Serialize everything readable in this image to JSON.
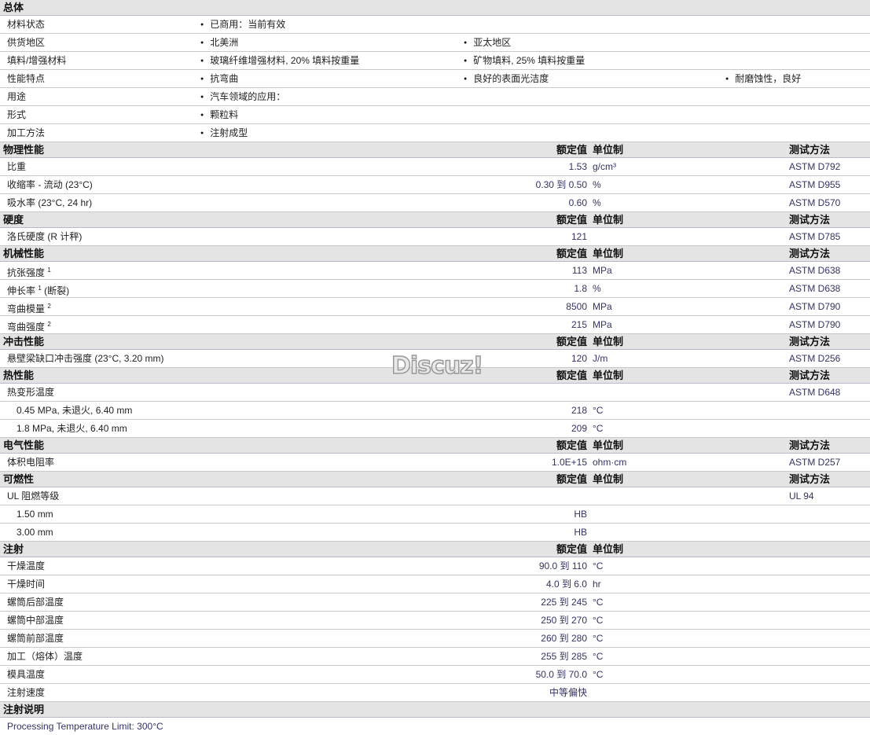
{
  "general": {
    "title": "总体",
    "rows": [
      {
        "label": "材料状态",
        "items": [
          "已商用：当前有效"
        ]
      },
      {
        "label": "供货地区",
        "items": [
          "北美洲",
          "亚太地区"
        ]
      },
      {
        "label": "填料/增强材料",
        "items": [
          "玻璃纤维增强材料, 20% 填料按重量",
          "矿物填料, 25% 填料按重量"
        ]
      },
      {
        "label": "性能特点",
        "items": [
          "抗弯曲",
          "良好的表面光洁度",
          "耐磨蚀性，良好"
        ]
      },
      {
        "label": "用途",
        "items": [
          "汽车领域的应用："
        ]
      },
      {
        "label": "形式",
        "items": [
          "颗粒料"
        ]
      },
      {
        "label": "加工方法",
        "items": [
          "注射成型"
        ]
      }
    ]
  },
  "columns": {
    "value": "额定值",
    "unit": "单位制",
    "method": "测试方法"
  },
  "sections": [
    {
      "title": "物理性能",
      "show_method": true,
      "rows": [
        {
          "label": "比重",
          "value": "1.53",
          "unit": "g/cm³",
          "method": "ASTM D792"
        },
        {
          "label": "收缩率 - 流动 (23°C)",
          "value": "0.30 到 0.50",
          "unit": "%",
          "method": "ASTM D955"
        },
        {
          "label": "吸水率 (23°C, 24 hr)",
          "value": "0.60",
          "unit": "%",
          "method": "ASTM D570"
        }
      ]
    },
    {
      "title": "硬度",
      "show_method": true,
      "rows": [
        {
          "label": "洛氏硬度 (R 计秤)",
          "value": "121",
          "unit": "",
          "method": "ASTM D785"
        }
      ]
    },
    {
      "title": "机械性能",
      "show_method": true,
      "rows": [
        {
          "label": "抗张强度",
          "sup": "1",
          "value": "113",
          "unit": "MPa",
          "method": "ASTM D638"
        },
        {
          "label": "伸长率",
          "sup": "1",
          "suffix": "(断裂)",
          "value": "1.8",
          "unit": "%",
          "method": "ASTM D638"
        },
        {
          "label": "弯曲模量",
          "sup": "2",
          "value": "8500",
          "unit": "MPa",
          "method": "ASTM D790"
        },
        {
          "label": "弯曲强度",
          "sup": "2",
          "value": "215",
          "unit": "MPa",
          "method": "ASTM D790"
        }
      ]
    },
    {
      "title": "冲击性能",
      "show_method": true,
      "rows": [
        {
          "label": "悬壁梁缺口冲击强度 (23°C, 3.20 mm)",
          "value": "120",
          "unit": "J/m",
          "method": "ASTM D256"
        }
      ]
    },
    {
      "title": "热性能",
      "show_method": true,
      "rows": [
        {
          "label": "热变形温度",
          "value": "",
          "unit": "",
          "method": "ASTM D648"
        },
        {
          "label": "0.45 MPa, 未退火, 6.40 mm",
          "sub": true,
          "value": "218",
          "unit": "°C",
          "method": ""
        },
        {
          "label": "1.8 MPa, 未退火, 6.40 mm",
          "sub": true,
          "value": "209",
          "unit": "°C",
          "method": ""
        }
      ]
    },
    {
      "title": "电气性能",
      "show_method": true,
      "rows": [
        {
          "label": "体积电阻率",
          "value": "1.0E+15",
          "unit": "ohm·cm",
          "method": "ASTM D257"
        }
      ]
    },
    {
      "title": "可燃性",
      "show_method": true,
      "rows": [
        {
          "label": "UL 阻燃等级",
          "value": "",
          "unit": "",
          "method": "UL 94"
        },
        {
          "label": "1.50 mm",
          "sub": true,
          "value": "HB",
          "unit": "",
          "method": ""
        },
        {
          "label": "3.00 mm",
          "sub": true,
          "value": "HB",
          "unit": "",
          "method": ""
        }
      ]
    },
    {
      "title": "注射",
      "show_method": false,
      "rows": [
        {
          "label": "干燥温度",
          "value": "90.0 到 110",
          "unit": "°C",
          "method": ""
        },
        {
          "label": "干燥时间",
          "value": "4.0 到 6.0",
          "unit": "hr",
          "method": ""
        },
        {
          "label": "螺筒后部温度",
          "value": "225 到 245",
          "unit": "°C",
          "method": ""
        },
        {
          "label": "螺筒中部温度",
          "value": "250 到 270",
          "unit": "°C",
          "method": ""
        },
        {
          "label": "螺筒前部温度",
          "value": "260 到 280",
          "unit": "°C",
          "method": ""
        },
        {
          "label": "加工（熔体）温度",
          "value": "255 到 285",
          "unit": "°C",
          "method": ""
        },
        {
          "label": "模具温度",
          "value": "50.0 到 70.0",
          "unit": "°C",
          "method": ""
        },
        {
          "label": "注射速度",
          "value": "中等偏快",
          "unit": "",
          "method": ""
        }
      ]
    }
  ],
  "notes": {
    "title": "注射说明",
    "text": "Processing Temperature Limit: 300°C"
  },
  "watermark": "Discuz!"
}
